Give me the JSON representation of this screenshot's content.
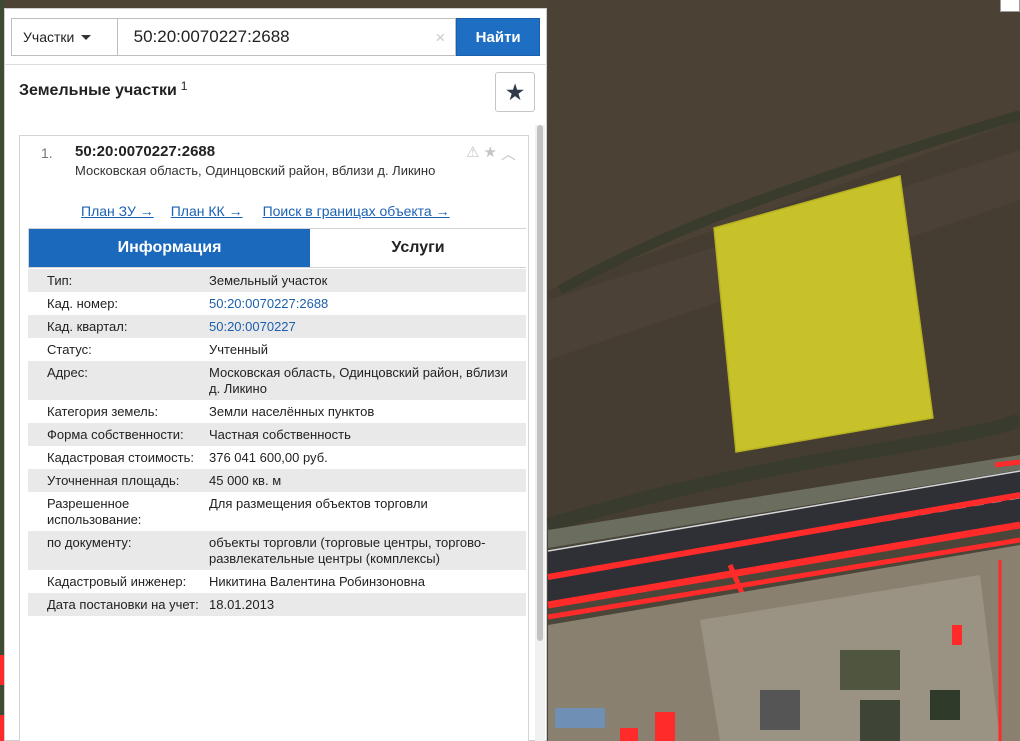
{
  "search": {
    "type_label": "Участки",
    "query": "50:20:0070227:2688",
    "clear_symbol": "×",
    "button_label": "Найти"
  },
  "panel": {
    "title": "Земельные участки",
    "count": "1",
    "favorite_icon": "★"
  },
  "result": {
    "number": "1.",
    "cad_number": "50:20:0070227:2688",
    "address": "Московская область, Одинцовский район, вблизи д. Ликино",
    "icons": {
      "warning": "⚠",
      "star": "★",
      "collapse": "︿"
    },
    "links": [
      "План ЗУ →",
      "План КК →",
      "Поиск в границах объекта →"
    ]
  },
  "tabs": [
    "Информация",
    "Услуги"
  ],
  "properties": [
    {
      "label": "Тип:",
      "value": "Земельный участок"
    },
    {
      "label": "Кад. номер:",
      "value": "50:20:0070227:2688"
    },
    {
      "label": "Кад. квартал:",
      "value": "50:20:0070227"
    },
    {
      "label": "Статус:",
      "value": "Учтенный"
    },
    {
      "label": "Адрес:",
      "value": "Московская область, Одинцовский район, вблизи д. Ликино"
    },
    {
      "label": "Категория земель:",
      "value": "Земли населённых пунктов"
    },
    {
      "label": "Форма собственности:",
      "value": "Частная собственность"
    },
    {
      "label": "Кадастровая стоимость:",
      "value": "376 041 600,00 руб."
    },
    {
      "label": "Уточненная площадь:",
      "value": "45 000 кв. м"
    },
    {
      "label": "Разрешенное использование:",
      "value": "Для размещения объектов торговли"
    },
    {
      "label": "по документу:",
      "value": "объекты торговли (торговые центры, торгово-развлекательные центры (комплексы)"
    },
    {
      "label": "Кадастровый инженер:",
      "value": "Никитина Валентина Робинзоновна"
    },
    {
      "label": "Дата постановки на учет:",
      "value": "18.01.2013"
    }
  ],
  "colors": {
    "accent": "#1a69bd",
    "parcel_fill": "#c8c22a",
    "road_highlight": "#ff2a2a"
  }
}
